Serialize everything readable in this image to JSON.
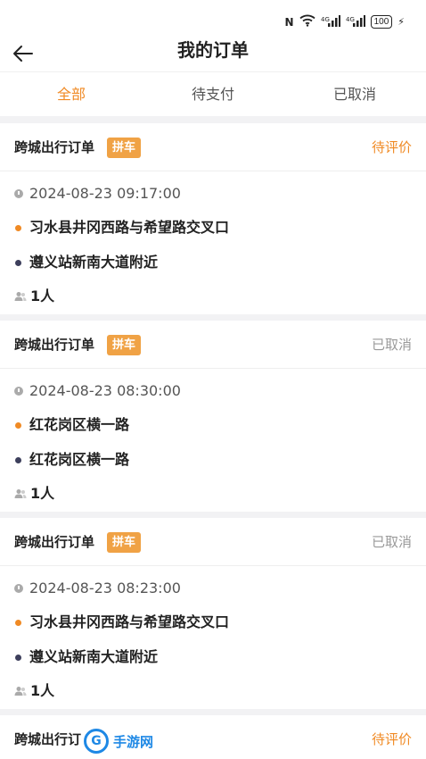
{
  "status_bar": {
    "nfc": "N",
    "signal_1": "⁴ᴳ",
    "signal_2": "⁴ᴳ",
    "battery": "100"
  },
  "header": {
    "title": "我的订单"
  },
  "tabs": [
    {
      "label": "全部",
      "active": true
    },
    {
      "label": "待支付",
      "active": false
    },
    {
      "label": "已取消",
      "active": false
    }
  ],
  "orders": [
    {
      "type": "跨城出行订单",
      "tag": "拼车",
      "status": "待评价",
      "time": "2024-08-23 09:17:00",
      "from": "习水县井冈西路与希望路交叉口",
      "to": "遵义站新南大道附近",
      "passengers": "1人"
    },
    {
      "type": "跨城出行订单",
      "tag": "拼车",
      "status": "已取消",
      "time": "2024-08-23 08:30:00",
      "from": "红花岗区横一路",
      "to": "红花岗区横一路",
      "passengers": "1人"
    },
    {
      "type": "跨城出行订单",
      "tag": "拼车",
      "status": "已取消",
      "time": "2024-08-23 08:23:00",
      "from": "习水县井冈西路与希望路交叉口",
      "to": "遵义站新南大道附近",
      "passengers": "1人"
    },
    {
      "type": "跨城出行订",
      "status": "待评价"
    }
  ],
  "watermark": {
    "logo": "G",
    "text": "手游网"
  },
  "colors": {
    "accent": "#f08a24",
    "tag_bg": "#f0a245",
    "muted": "#999999"
  }
}
